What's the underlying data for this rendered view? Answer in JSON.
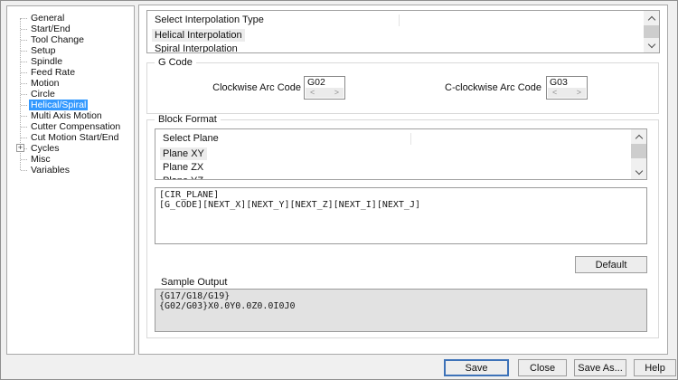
{
  "tree": {
    "expander_glyph": "+",
    "items": [
      {
        "label": "General",
        "selected": false
      },
      {
        "label": "Start/End",
        "selected": false
      },
      {
        "label": "Tool Change",
        "selected": false
      },
      {
        "label": "Setup",
        "selected": false
      },
      {
        "label": "Spindle",
        "selected": false
      },
      {
        "label": "Feed Rate",
        "selected": false
      },
      {
        "label": "Motion",
        "selected": false
      },
      {
        "label": "Circle",
        "selected": false
      },
      {
        "label": "Helical/Spiral",
        "selected": true
      },
      {
        "label": "Multi Axis Motion",
        "selected": false
      },
      {
        "label": "Cutter Compensation",
        "selected": false
      },
      {
        "label": "Cut Motion Start/End",
        "selected": false
      },
      {
        "label": "Cycles",
        "selected": false,
        "expandable": true
      },
      {
        "label": "Misc",
        "selected": false
      },
      {
        "label": "Variables",
        "selected": false
      }
    ]
  },
  "interpolation": {
    "header": "Select Interpolation Type",
    "items": [
      {
        "label": "Helical Interpolation",
        "selected": true
      },
      {
        "label": "Spiral Interpolation",
        "selected": false
      }
    ]
  },
  "gcode": {
    "group_label": "G Code",
    "clockwise_label": "Clockwise Arc Code",
    "clockwise_value": "G02",
    "cclockwise_label": "C-clockwise Arc Code",
    "cclockwise_value": "G03",
    "spinner_prev_glyph": "<",
    "spinner_next_glyph": ">"
  },
  "block_format": {
    "group_label": "Block Format",
    "plane_header": "Select Plane",
    "plane_items": [
      {
        "label": "Plane XY",
        "selected": true
      },
      {
        "label": "Plane ZX",
        "selected": false
      },
      {
        "label": "Plane YZ",
        "selected": false
      }
    ],
    "format_text": "[CIR_PLANE]\n[G_CODE][NEXT_X][NEXT_Y][NEXT_Z][NEXT_I][NEXT_J]",
    "default_button": "Default",
    "sample_label": "Sample Output",
    "sample_text": "{G17/G18/G19}\n{G02/G03}X0.0Y0.0Z0.0I0J0"
  },
  "buttons": {
    "save": "Save",
    "close": "Close",
    "save_as": "Save As...",
    "help": "Help"
  },
  "colors": {
    "tree_selection": "#3399ff",
    "list_selection": "#ececec",
    "save_focus_border": "#3d72b8",
    "dialog_background": "#f0f0f0",
    "sample_box_background": "#e2e2e2"
  }
}
